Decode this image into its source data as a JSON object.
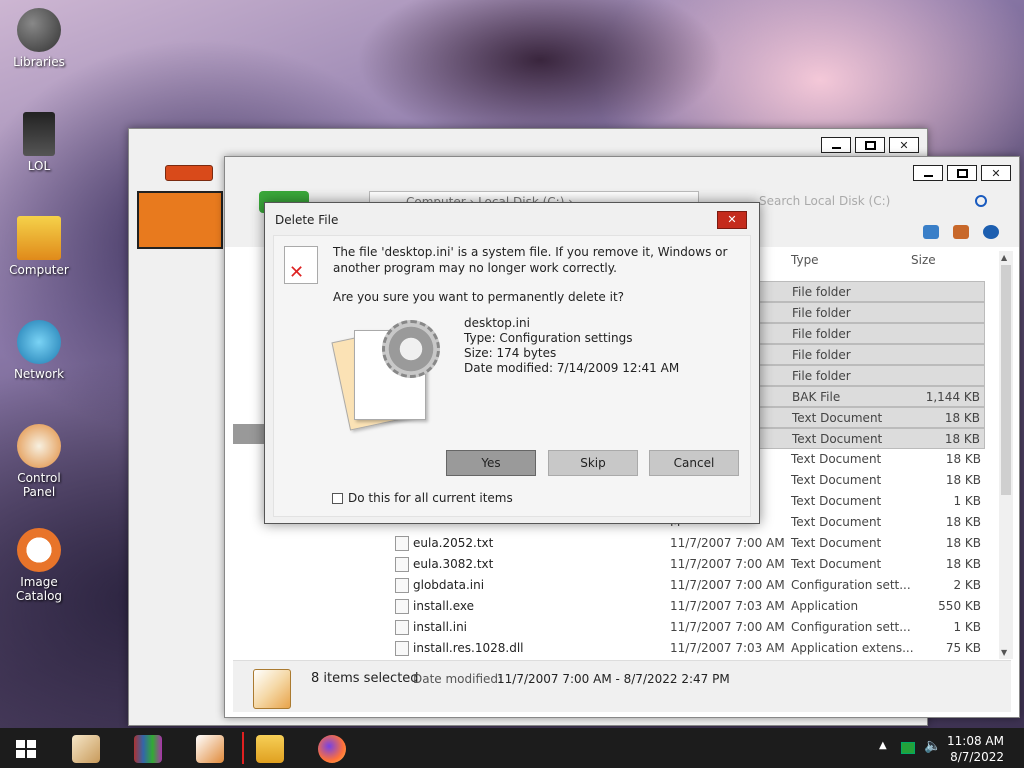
{
  "desktop": {
    "icons": [
      {
        "label": "Libraries"
      },
      {
        "label": "LOL"
      },
      {
        "label": "Computer"
      },
      {
        "label": "Network"
      },
      {
        "label": "Control Panel"
      },
      {
        "label": "Image Catalog"
      }
    ]
  },
  "explorer": {
    "address": "Computer  ›  Local Disk (C:)  ›",
    "search_placeholder": "Search Local Disk (C:)",
    "columns": {
      "type": "Type",
      "size": "Size"
    },
    "files": [
      {
        "name": "",
        "date": "",
        "type": "File folder",
        "size": "",
        "selected": true
      },
      {
        "name": "",
        "date": "",
        "type": "File folder",
        "size": "",
        "selected": true
      },
      {
        "name": "",
        "date": "M",
        "type": "File folder",
        "size": "",
        "selected": true
      },
      {
        "name": "",
        "date": "",
        "type": "File folder",
        "size": "",
        "selected": true
      },
      {
        "name": "",
        "date": "",
        "type": "File folder",
        "size": "",
        "selected": true
      },
      {
        "name": "",
        "date": "",
        "type": "BAK File",
        "size": "1,144 KB",
        "selected": true
      },
      {
        "name": "",
        "date": "M",
        "type": "Text Document",
        "size": "18 KB",
        "selected": true
      },
      {
        "name": "",
        "date": "M",
        "type": "Text Document",
        "size": "18 KB",
        "selected": true
      },
      {
        "name": "",
        "date": "M",
        "type": "Text Document",
        "size": "18 KB",
        "selected": false
      },
      {
        "name": "",
        "date": "M",
        "type": "Text Document",
        "size": "18 KB",
        "selected": false
      },
      {
        "name": "",
        "date": "M",
        "type": "Text Document",
        "size": "1 KB",
        "selected": false
      },
      {
        "name": "",
        "date": "M",
        "type": "Text Document",
        "size": "18 KB",
        "selected": false
      },
      {
        "name": "eula.2052.txt",
        "date": "11/7/2007 7:00 AM",
        "type": "Text Document",
        "size": "18 KB",
        "selected": false
      },
      {
        "name": "eula.3082.txt",
        "date": "11/7/2007 7:00 AM",
        "type": "Text Document",
        "size": "18 KB",
        "selected": false
      },
      {
        "name": "globdata.ini",
        "date": "11/7/2007 7:00 AM",
        "type": "Configuration sett...",
        "size": "2 KB",
        "selected": false
      },
      {
        "name": "install.exe",
        "date": "11/7/2007 7:03 AM",
        "type": "Application",
        "size": "550 KB",
        "selected": false
      },
      {
        "name": "install.ini",
        "date": "11/7/2007 7:00 AM",
        "type": "Configuration sett...",
        "size": "1 KB",
        "selected": false
      },
      {
        "name": "install.res.1028.dll",
        "date": "11/7/2007 7:03 AM",
        "type": "Application extens...",
        "size": "75 KB",
        "selected": false
      }
    ],
    "status": {
      "count": "8 items selected",
      "date_label": "Date modified:",
      "date_value": "11/7/2007 7:00 AM - 8/7/2022 2:47 PM"
    }
  },
  "dialog": {
    "title": "Delete File",
    "message": "The file 'desktop.ini' is a system file. If you remove it, Windows or another program may no longer work correctly.",
    "question": "Are you sure you want to permanently delete it?",
    "file": {
      "name": "desktop.ini",
      "type": "Type: Configuration settings",
      "size": "Size: 174 bytes",
      "modified": "Date modified: 7/14/2009 12:41 AM"
    },
    "buttons": {
      "yes": "Yes",
      "skip": "Skip",
      "cancel": "Cancel"
    },
    "checkbox_label": "Do this for all current items"
  },
  "taskbar": {
    "time": "11:08 AM",
    "date": "8/7/2022"
  }
}
